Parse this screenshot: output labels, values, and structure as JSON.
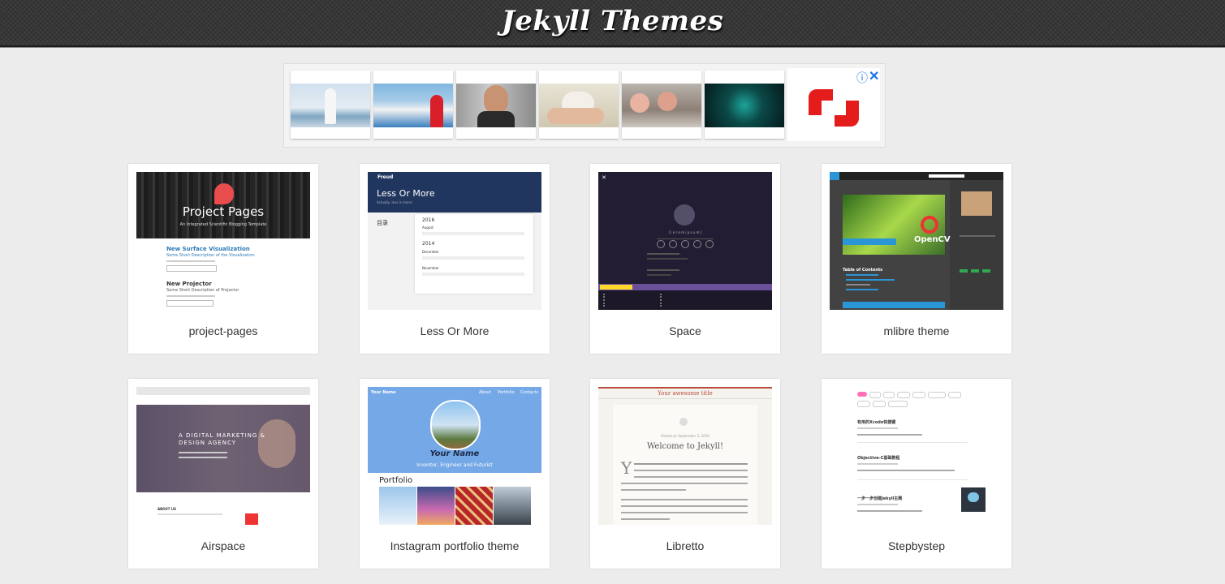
{
  "header": {
    "title": "Jekyll Themes"
  },
  "ad": {
    "info_icon": "ⓘ",
    "close_icon": "✕",
    "brand_color": "#e41c1c"
  },
  "themes": [
    {
      "name": "project-pages",
      "preview": {
        "hero_title": "Project Pages",
        "hero_subtitle": "An Integrated Scientific Blogging Template",
        "post1_title": "New Surface Visualization",
        "post1_sub": "Some Short Description of the Visualization",
        "post2_title": "New Projector",
        "post2_sub": "Some Short Description of Projector"
      }
    },
    {
      "name": "Less Or More",
      "preview": {
        "brand": "Freud",
        "hero_title": "Less Or More",
        "hero_sub": "Actually, less is more!",
        "toc": "目录",
        "year1": "2016",
        "month1": "August",
        "year2": "2014",
        "month2": "December",
        "month3": "November"
      }
    },
    {
      "name": "Space",
      "preview": {
        "tagline": "[ l o r e m   i p s u m ]"
      }
    },
    {
      "name": "mlibre theme",
      "preview": {
        "opencv": "OpenCV",
        "toc": "Table of Contents"
      }
    },
    {
      "name": "Airspace",
      "preview": {
        "hero": "A DIGITAL MARKETING & DESIGN AGENCY",
        "about": "ABOUT US"
      }
    },
    {
      "name": "Instagram portfolio theme",
      "preview": {
        "site": "Your Name",
        "nav1": "About",
        "nav2": "Portfolio",
        "nav3": "Contacts",
        "name": "Your Name",
        "sub": "Inventor, Engineer and Futurist",
        "section": "Portfolio"
      }
    },
    {
      "name": "Libretto",
      "preview": {
        "site_title": "Your awesome title",
        "date": "Posted on September 3, 2016",
        "post_title": "Welcome to Jekyll!",
        "drop": "Y"
      }
    },
    {
      "name": "Stepbystep",
      "preview": {
        "post1": "有用的Xcode快捷键",
        "post2": "Objective-C基础教程",
        "post3": "一步一步创建Jekyll主题"
      }
    }
  ]
}
